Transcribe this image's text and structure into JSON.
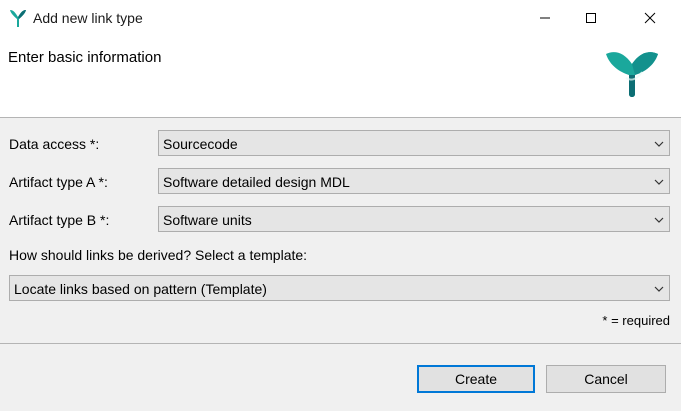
{
  "window": {
    "title": "Add new link type"
  },
  "header": {
    "title": "Enter basic information"
  },
  "form": {
    "data_access": {
      "label": "Data access *:",
      "value": "Sourcecode"
    },
    "artifact_a": {
      "label": "Artifact type A *:",
      "value": "Software detailed design MDL"
    },
    "artifact_b": {
      "label": "Artifact type B *:",
      "value": "Software units"
    },
    "derive_prompt": "How should links be derived? Select a template:",
    "template": {
      "value": "Locate links based on pattern (Template)"
    },
    "required_note": "* = required"
  },
  "buttons": {
    "create": "Create",
    "cancel": "Cancel"
  },
  "colors": {
    "logo_primary": "#1aa89c",
    "logo_dark": "#0d6e74",
    "focus_border": "#0078d7"
  },
  "icons": {
    "app": "ribbon-logo-icon",
    "minimize": "minimize-icon",
    "maximize": "maximize-icon",
    "close": "close-icon",
    "dropdown": "chevron-down-icon"
  }
}
